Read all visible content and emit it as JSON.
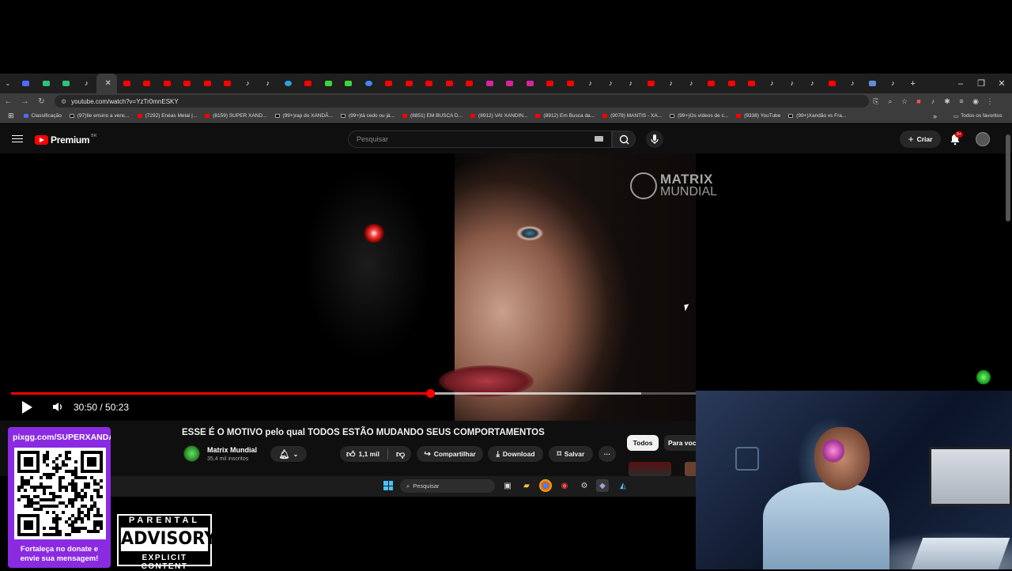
{
  "browser": {
    "active_tab_close": "✕",
    "new_tab": "+",
    "window_controls": [
      "–",
      "❐",
      "✕"
    ],
    "url": "youtube.com/watch?v=YzTr0mnESKY",
    "bookmarks": [
      {
        "label": "Classificação",
        "kind": "gg"
      },
      {
        "label": "(97)Ile ensino a venc...",
        "kind": "tk"
      },
      {
        "label": "(7292) Enéas Metal |...",
        "kind": "yt"
      },
      {
        "label": "(8159) SUPER XAND...",
        "kind": "yt"
      },
      {
        "label": "(99+)rap do XANDÃ...",
        "kind": "tk"
      },
      {
        "label": "(99+)tá cedo ou já...",
        "kind": "tk"
      },
      {
        "label": "(8851) EM BUSCA D...",
        "kind": "yt"
      },
      {
        "label": "(8912) VAI XANDIN...",
        "kind": "yt"
      },
      {
        "label": "(8912) Em Busca da...",
        "kind": "yt"
      },
      {
        "label": "(9078) MANTIS - XA...",
        "kind": "yt"
      },
      {
        "label": "(99+)Os vídeos de c...",
        "kind": "tk"
      },
      {
        "label": "(9338) YouTube",
        "kind": "yt"
      },
      {
        "label": "(99+)Xandão vs Fra...",
        "kind": "tk"
      }
    ],
    "bookmarks_more": "»",
    "all_bookmarks": "Todos os favoritos"
  },
  "youtube": {
    "logo_text": "Premium",
    "logo_country": "BR",
    "search_placeholder": "Pesquisar",
    "create_label": "Criar",
    "notifications_badge": "9+"
  },
  "video": {
    "watermark_line1": "MATRIX",
    "watermark_line2": "MUNDIAL",
    "current_time": "30:50",
    "duration": "50:23",
    "time_display": "30:50 / 50:23",
    "progress": 0.613,
    "buffered": 0.92
  },
  "details": {
    "title": "ESSE É O MOTIVO pelo qual TODOS ESTÃO MUDANDO SEUS COMPORTAMENTOS",
    "channel_name": "Matrix Mundial",
    "subscribers": "35,4 mil inscritos",
    "likes": "1,1 mil",
    "share_label": "Compartilhar",
    "download_label": "Download",
    "save_label": "Salvar",
    "more_label": "···",
    "chips": [
      "Todos",
      "Para você"
    ]
  },
  "taskbar": {
    "search_label": "Pesquisar"
  },
  "overlay": {
    "donate_url": "pixgg.com/SUPERXANDAO",
    "donate_message": "Fortaleça no donate e envie sua mensagem!",
    "advisory_top": "PARENTAL",
    "advisory_mid": "ADVISORY",
    "advisory_bottom": "EXPLICIT CONTENT"
  },
  "colors": {
    "accent": "#ff0000",
    "donate_bg": "#8a2be2",
    "yt_bg": "#0f0f0f"
  }
}
